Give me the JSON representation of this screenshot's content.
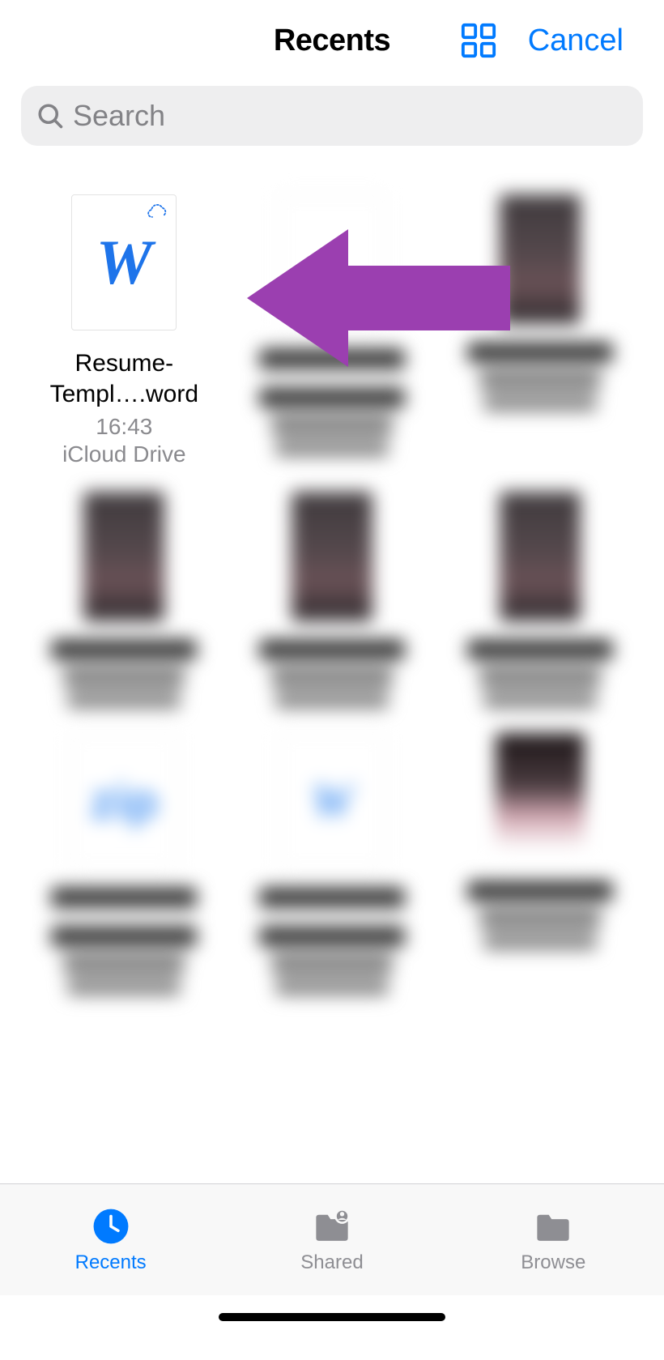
{
  "header": {
    "title": "Recents",
    "cancel": "Cancel"
  },
  "search": {
    "placeholder": "Search"
  },
  "files": {
    "main": {
      "name": "Resume- Templ….word",
      "time": "16:43",
      "location": "iCloud Drive",
      "icon_letter": "W"
    }
  },
  "tabs": {
    "recents": "Recents",
    "shared": "Shared",
    "browse": "Browse"
  }
}
